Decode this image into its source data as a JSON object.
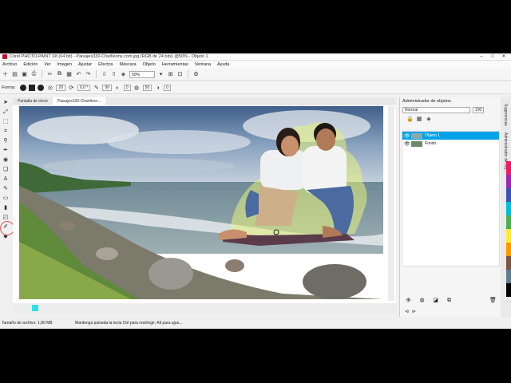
{
  "window": {
    "title": "Corel PHOTO-PAINT X8 (64 bit) - Paisajes330-Charlleons.com.jpg (RGB de 24 bits) @50% - Objeto 1"
  },
  "menu": [
    "Archivo",
    "Edición",
    "Ver",
    "Imagen",
    "Ajustar",
    "Efectos",
    "Máscara",
    "Objeto",
    "Herramientas",
    "Ventana",
    "Ayuda"
  ],
  "toolbar": {
    "zoom": "50%"
  },
  "property_bar": {
    "label": "Forma:",
    "size1": "20",
    "size2": "0,0 °",
    "opacity": "99",
    "value4": "0",
    "value5": "50",
    "value6": "0"
  },
  "tabs": [
    "Pantalla de inicio",
    "Paisajes330-Charlleon..."
  ],
  "status": {
    "file_size": "Tamaño de archivo: 1,80 MB",
    "hint": "Mantenga pulsada la tecla Ctrl para restringir; Alt para ajus..."
  },
  "object_manager": {
    "title": "Administrador de objetos",
    "mode": "Normal",
    "opacity": "100",
    "objects": [
      {
        "name": "Objeto 1",
        "selected": true
      },
      {
        "name": "Fondo",
        "selected": false
      }
    ]
  },
  "side_tabs": [
    "Sugerencias",
    "Administrador de obj..."
  ],
  "colors": {
    "selection": "#00a2e8",
    "swatch": "#2de0e7",
    "brand": "#c8102e"
  }
}
